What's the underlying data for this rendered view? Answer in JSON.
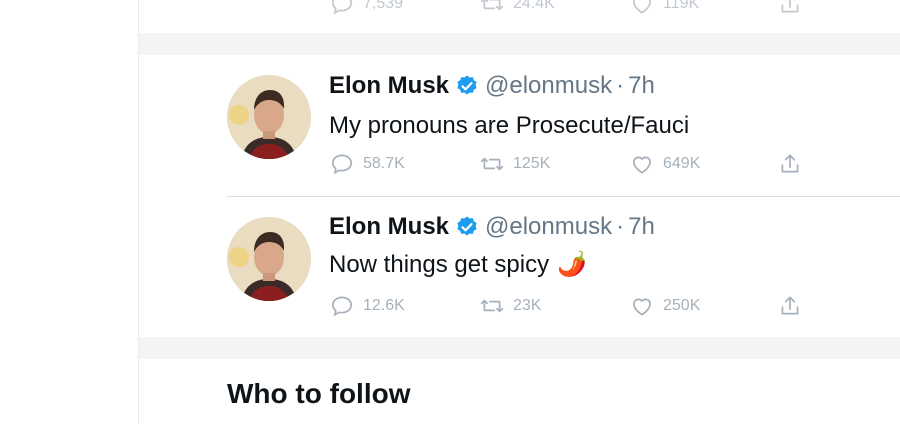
{
  "prev_tweet": {
    "replies": "7,539",
    "retweets": "24.4K",
    "likes": "119K"
  },
  "tweets": [
    {
      "name": "Elon Musk",
      "handle": "@elonmusk",
      "sep": "·",
      "time": "7h",
      "text": "My pronouns are Prosecute/Fauci",
      "emoji": "",
      "replies": "58.7K",
      "retweets": "125K",
      "likes": "649K"
    },
    {
      "name": "Elon Musk",
      "handle": "@elonmusk",
      "sep": "·",
      "time": "7h",
      "text": "Now things get spicy",
      "emoji": "🌶️",
      "replies": "12.6K",
      "retweets": "23K",
      "likes": "250K"
    }
  ],
  "who_to_follow": {
    "title": "Who to follow"
  },
  "colors": {
    "verified": "#1d9bf0",
    "muted": "#a7b1bb",
    "band": "#f2f4f6"
  }
}
